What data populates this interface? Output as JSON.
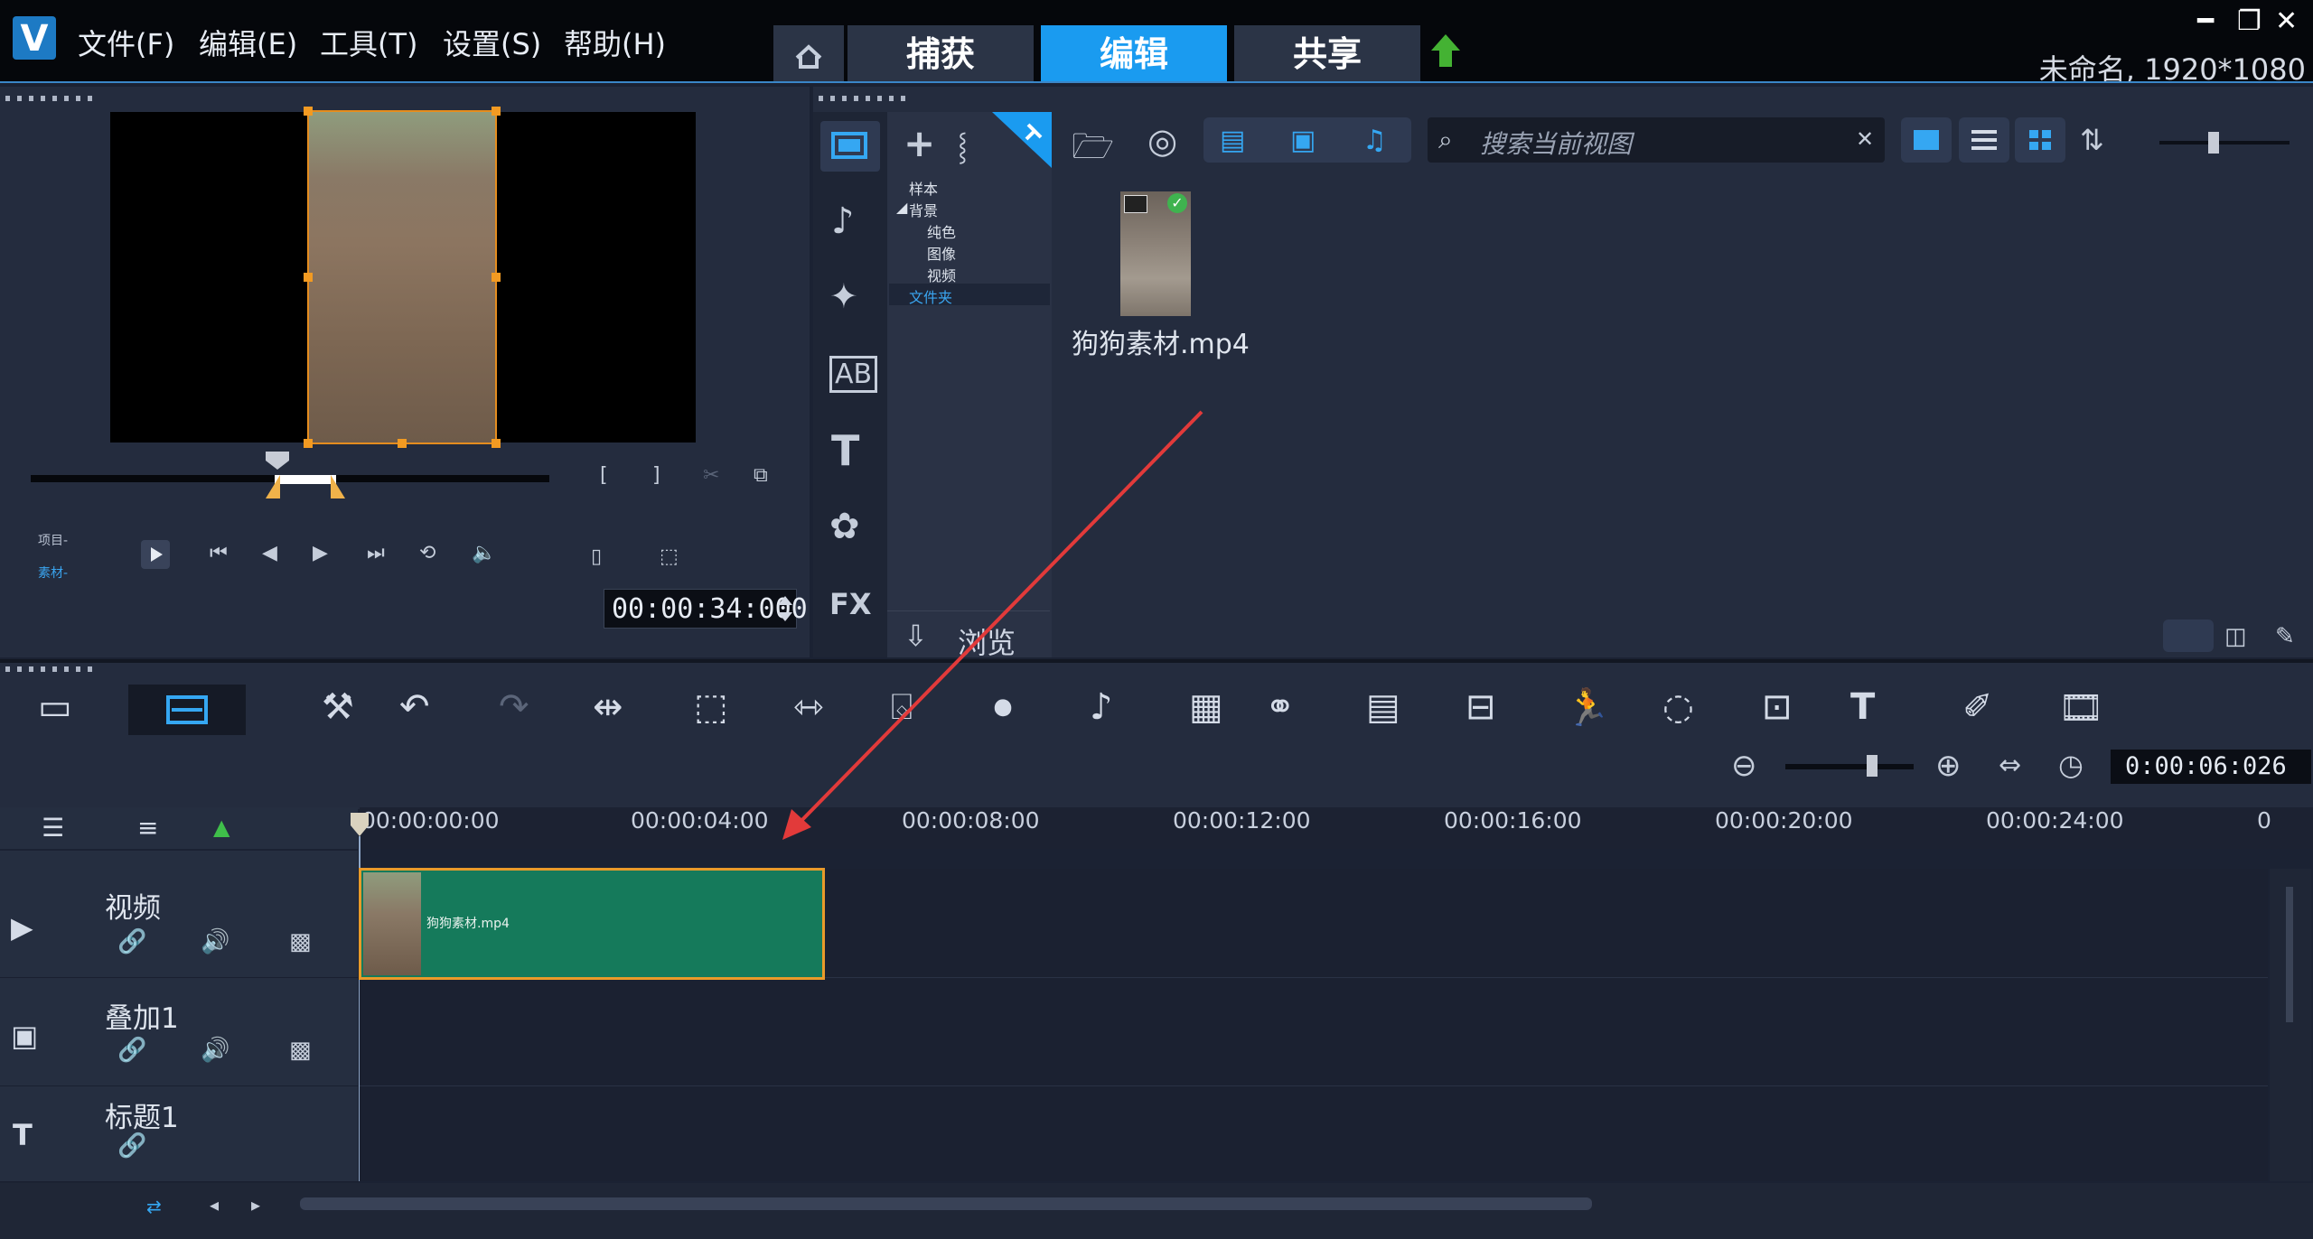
{
  "menu": [
    "文件(F)",
    "编辑(E)",
    "工具(T)",
    "设置(S)",
    "帮助(H)"
  ],
  "tabs": {
    "capture": "捕获",
    "edit": "编辑",
    "share": "共享"
  },
  "window_controls": {
    "minimize": "━",
    "restore": "❐",
    "close": "✕"
  },
  "doc_info": "未命名, 1920*1080",
  "preview": {
    "project_label": "项目-",
    "clip_label": "素材-",
    "timecode": "00:00:34:000"
  },
  "library": {
    "tree": [
      "样本",
      "背景",
      "纯色",
      "图像",
      "视频",
      "文件夹"
    ],
    "search_placeholder": "搜索当前视图",
    "browse_label": "浏览",
    "media_items": [
      {
        "name": "狗狗素材.mp4"
      }
    ]
  },
  "timeline": {
    "zoom_time": "0:00:06:026",
    "ruler_labels": [
      "00:00:00:00",
      "00:00:04:00",
      "00:00:08:00",
      "00:00:12:00",
      "00:00:16:00",
      "00:00:20:00",
      "00:00:24:00",
      "0"
    ],
    "tracks": [
      {
        "name": "视频"
      },
      {
        "name": "叠加1"
      },
      {
        "name": "标题1"
      }
    ],
    "clip_name": "狗狗素材.mp4"
  },
  "colors": {
    "accent_tab": "#1a9bf0",
    "clip_fill": "#157a5b",
    "clip_border": "#e99a2a",
    "arrow": "#e23a3a"
  },
  "icons": [
    "home-icon",
    "upload-icon",
    "play-icon",
    "prev-frame-icon",
    "next-frame-icon",
    "repeat-icon",
    "volume-icon",
    "folder-add-icon",
    "search-icon",
    "text-icon",
    "fx-icon",
    "undo-icon",
    "redo-icon",
    "zoom-in-icon",
    "zoom-out-icon"
  ]
}
